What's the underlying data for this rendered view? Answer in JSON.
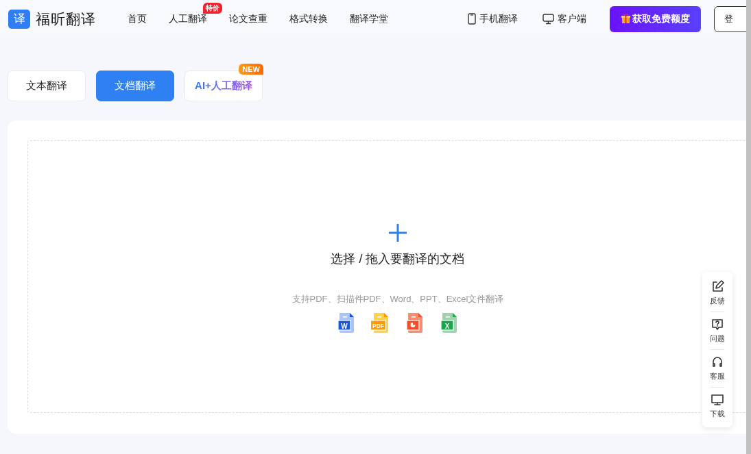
{
  "header": {
    "logo_mark": "译",
    "logo_text": "福昕翻译",
    "nav": [
      {
        "label": "首页"
      },
      {
        "label": "人工翻译",
        "badge": "特价"
      },
      {
        "label": "论文查重"
      },
      {
        "label": "格式转换"
      },
      {
        "label": "翻译学堂"
      }
    ],
    "links": [
      {
        "kind": "phone",
        "label": "手机翻译"
      },
      {
        "kind": "desktop",
        "label": "客户端"
      }
    ],
    "promo_button": "获取免费额度",
    "login_button": "登"
  },
  "mode_tabs": [
    {
      "label": "文本翻译",
      "selected": false,
      "kind": "plain"
    },
    {
      "label": "文档翻译",
      "selected": true,
      "kind": "plain"
    },
    {
      "label": "AI+人工翻译",
      "selected": false,
      "badge": "NEW",
      "kind": "gradient"
    }
  ],
  "upload": {
    "title": "选择 / 拖入要翻译的文档",
    "hint": "支持PDF、扫描件PDF、Word、PPT、Excel文件翻译",
    "file_types": [
      {
        "kind": "word",
        "label": "W",
        "color": "#1a56db"
      },
      {
        "kind": "pdf",
        "label": "PDF",
        "color": "#ff9a00"
      },
      {
        "kind": "ppt",
        "color": "#f0502c"
      },
      {
        "kind": "excel",
        "label": "X",
        "color": "#1aa64b"
      }
    ]
  },
  "side_panel": [
    {
      "kind": "feedback",
      "label": "反馈"
    },
    {
      "kind": "question",
      "label": "问题"
    },
    {
      "kind": "service",
      "label": "客服"
    },
    {
      "kind": "download",
      "label": "下载"
    }
  ]
}
